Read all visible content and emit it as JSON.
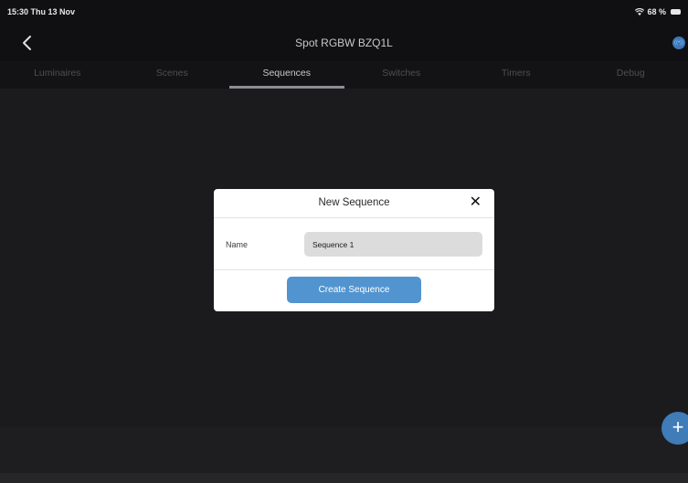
{
  "status_bar": {
    "time_date": "15:30  Thu 13 Nov",
    "battery": "68 %",
    "wifi_icon": "wifi-icon",
    "battery_icon": "battery-icon"
  },
  "nav": {
    "title": "Spot RGBW BZQ1L",
    "back_icon": "chevron-left-icon",
    "action_icon": "network-icon",
    "action_glyph": "((•))"
  },
  "tabs": [
    {
      "label": "Luminaires",
      "active": false
    },
    {
      "label": "Scenes",
      "active": false
    },
    {
      "label": "Sequences",
      "active": true
    },
    {
      "label": "Switches",
      "active": false
    },
    {
      "label": "Timers",
      "active": false
    },
    {
      "label": "Debug",
      "active": false
    }
  ],
  "modal": {
    "title": "New Sequence",
    "close_glyph": "✕",
    "name_label": "Name",
    "name_value": "Sequence 1",
    "create_label": "Create Sequence"
  },
  "fab": {
    "glyph": "+",
    "icon": "plus-icon"
  },
  "colors": {
    "accent": "#5294cf",
    "fab": "#3f7cb8",
    "background": "#1b1b1d"
  }
}
